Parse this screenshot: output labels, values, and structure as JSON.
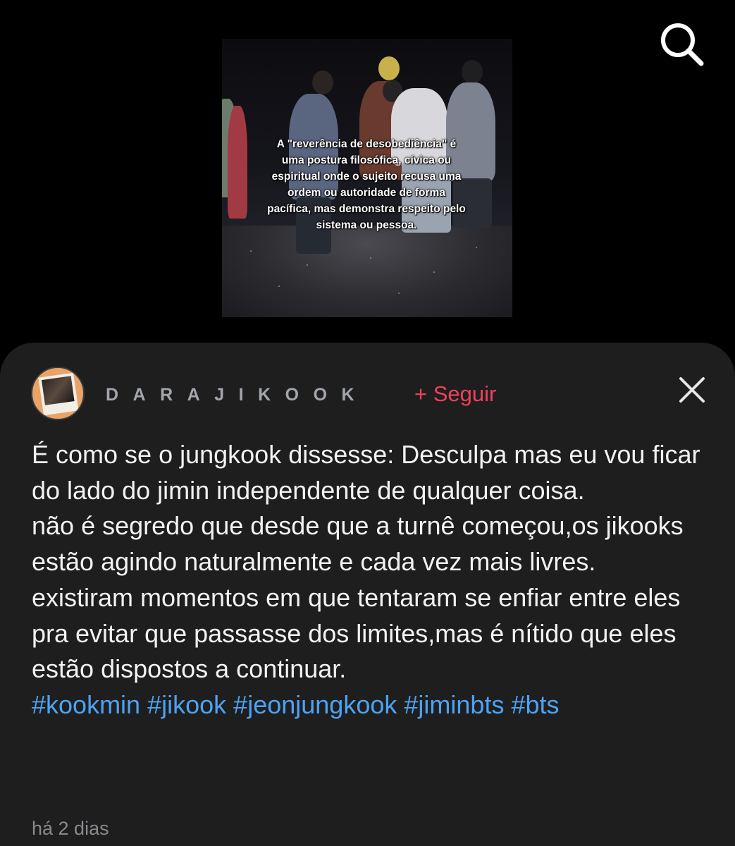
{
  "video": {
    "overlay_text": "A \"reverência de desobediência\" é uma postura filosófica, cívica ou espiritual onde o sujeito recusa uma ordem ou autoridade de forma pacífica, mas demonstra respeito pelo sistema ou pessoa."
  },
  "header": {
    "search_icon": "search-icon"
  },
  "author": {
    "name": "DARAJIKOOK",
    "follow_label": "+ Seguir",
    "close_icon": "close-icon"
  },
  "caption": {
    "paragraphs": [
      "É como se o jungkook dissesse: Desculpa mas eu vou ficar do lado do jimin independente de qualquer coisa.",
      "não é segredo que desde que a turnê começou,os jikooks estão agindo naturalmente e cada vez mais livres.",
      "existiram momentos em que tentaram se enfiar entre eles pra evitar que passasse dos limites,mas é nítido que eles estão dispostos a continuar."
    ],
    "hashtags": [
      "#kookmin",
      "#jikook",
      "#jeonjungkook",
      "#jiminbts",
      "#bts"
    ]
  },
  "timestamp": "há 2 dias",
  "colors": {
    "panel_bg": "#1e1e1f",
    "follow_accent": "#f0405c",
    "hashtag": "#4da3f3",
    "muted_text": "#8a8a8e"
  }
}
